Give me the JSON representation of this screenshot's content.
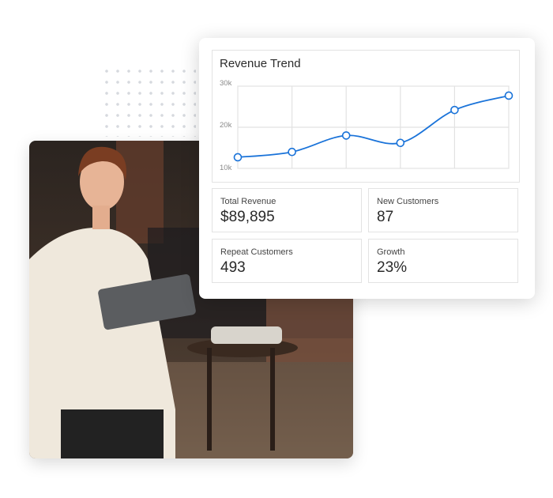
{
  "colors": {
    "accent": "#1a73d9",
    "grid": "#e2e2e2"
  },
  "photo": {
    "description_icon": "woman-with-tablet-photo"
  },
  "dashboard": {
    "chart": {
      "title": "Revenue Trend"
    },
    "stats": [
      {
        "label": "Total Revenue",
        "value": "$89,895"
      },
      {
        "label": "New Customers",
        "value": "87"
      },
      {
        "label": "Repeat Customers",
        "value": "493"
      },
      {
        "label": "Growth",
        "value": "23%"
      }
    ]
  },
  "chart_data": {
    "type": "line",
    "title": "Revenue Trend",
    "yticks": [
      "10k",
      "20k",
      "30k"
    ],
    "ylim": [
      10000,
      30000
    ],
    "x": [
      1,
      2,
      3,
      4,
      5,
      6
    ],
    "values": [
      12700,
      14000,
      18000,
      16200,
      24200,
      27700
    ],
    "grid": true,
    "smooth": true
  }
}
